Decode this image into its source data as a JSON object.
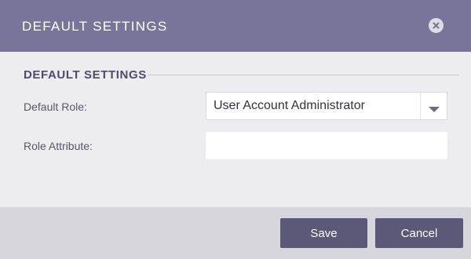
{
  "dialog": {
    "title": "DEFAULT SETTINGS",
    "close_icon": "close-circle-icon"
  },
  "section": {
    "title": "DEFAULT SETTINGS"
  },
  "fields": {
    "role": {
      "label": "Default Role:",
      "value": "User Account Administrator",
      "dropdown_icon": "caret-down-icon"
    },
    "attribute": {
      "label": "Role Attribute:",
      "value": "",
      "placeholder": ""
    }
  },
  "footer": {
    "save_label": "Save",
    "cancel_label": "Cancel"
  },
  "colors": {
    "header_bg": "#79749a",
    "body_bg": "#ededf0",
    "footer_bg": "#d6d6dc",
    "button_bg": "#5b5878",
    "section_title": "#4e4a6c"
  }
}
